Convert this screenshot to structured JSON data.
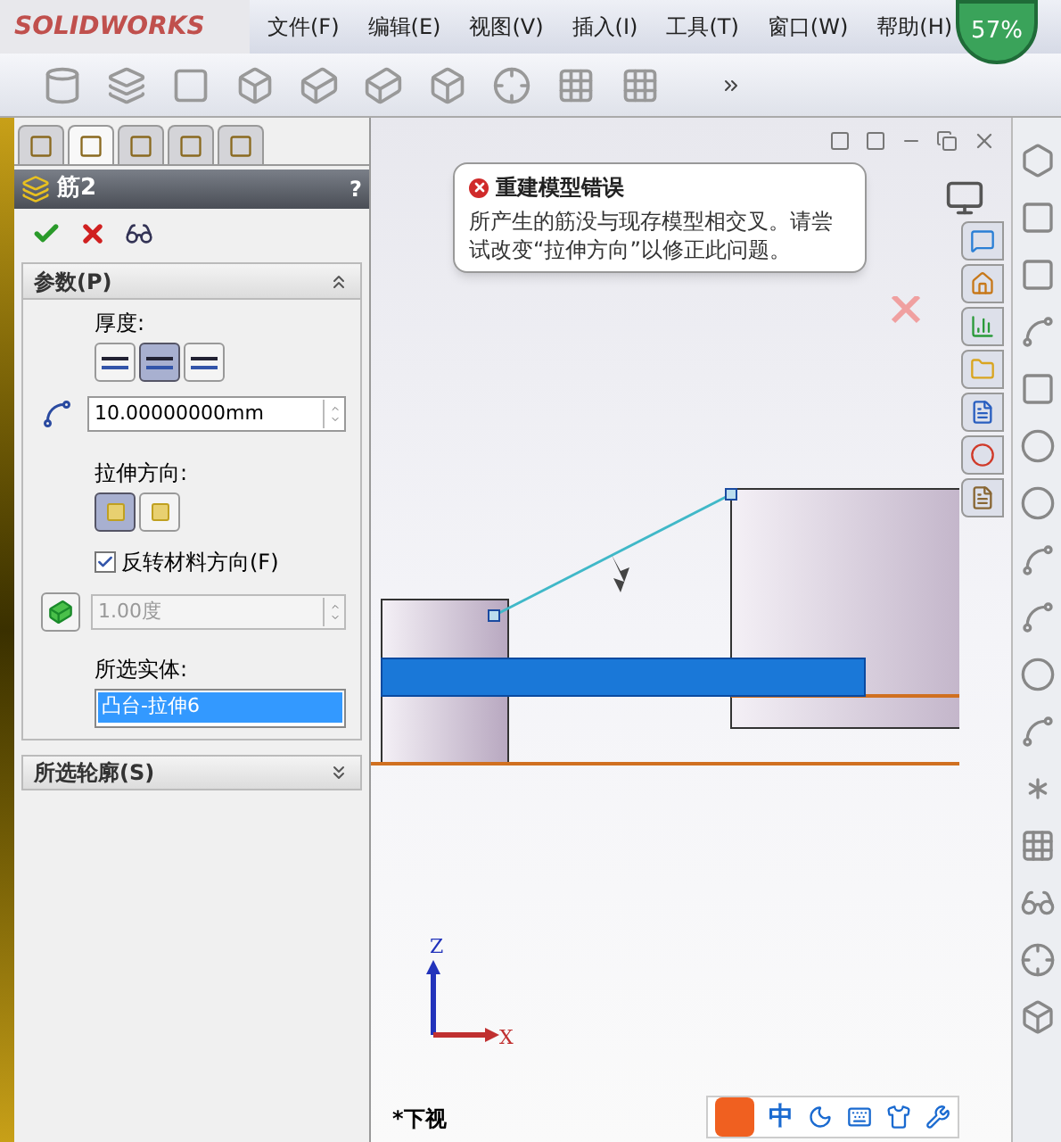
{
  "app": {
    "logo": "SOLIDWORKS",
    "menus": [
      "文件(F)",
      "编辑(E)",
      "视图(V)",
      "插入(I)",
      "工具(T)",
      "窗口(W)",
      "帮助(H)"
    ],
    "cpu_badge": "57%"
  },
  "panel_tabs": [
    {
      "selected": false
    },
    {
      "selected": true
    },
    {
      "selected": false
    },
    {
      "selected": false
    },
    {
      "selected": false
    }
  ],
  "property_manager": {
    "title": "筋2",
    "help": "?",
    "parameters": {
      "heading": "参数(P)",
      "expanded": true,
      "thickness_label": "厚度:",
      "thickness_options": [
        {
          "selected": false
        },
        {
          "selected": true
        },
        {
          "selected": false
        }
      ],
      "thickness_value": "10.00000000mm",
      "direction_label": "拉伸方向:",
      "direction_options": [
        {
          "selected": true
        },
        {
          "selected": false
        }
      ],
      "flip_material": {
        "label": "反转材料方向(F)",
        "checked": true
      },
      "draft": {
        "value": "1.00度",
        "disabled": true
      },
      "bodies_label": "所选实体:",
      "bodies": [
        {
          "label": "凸台-拉伸6",
          "selected": true
        }
      ]
    },
    "profiles": {
      "heading": "所选轮廓(S)",
      "expanded": false
    }
  },
  "error_tip": {
    "title": "重建模型错误",
    "message": "所产生的筋没与现存模型相交叉。请尝试改变“拉伸方向”以修正此问题。"
  },
  "viewport": {
    "axes": [
      "Z",
      "X"
    ],
    "view_name": "*下视"
  },
  "ime_bar": {
    "mode": "中"
  }
}
